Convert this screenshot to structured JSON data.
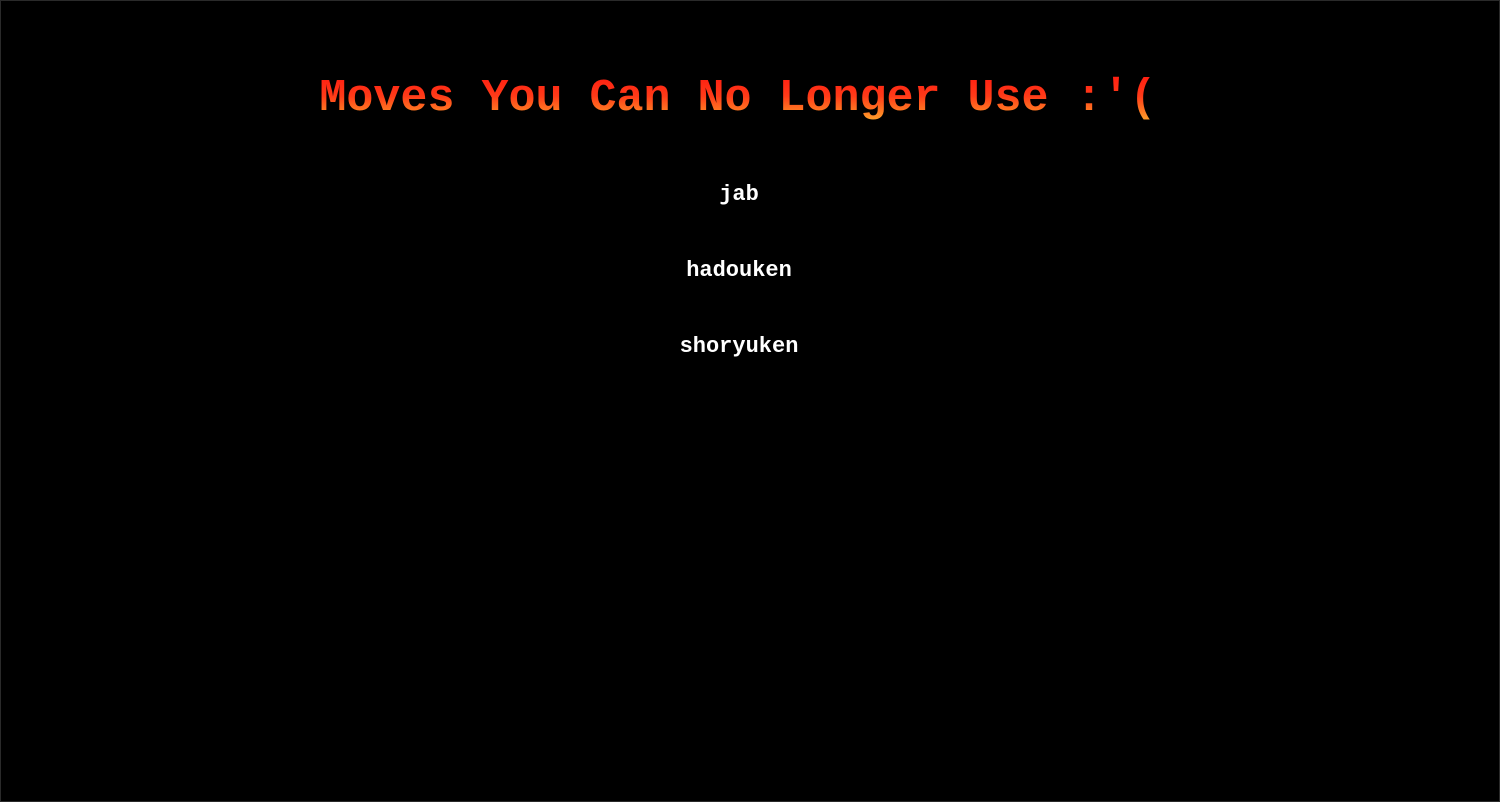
{
  "page": {
    "title": "Moves You Can No Longer Use :'(",
    "moves": [
      {
        "label": "jab"
      },
      {
        "label": "hadouken"
      },
      {
        "label": "shoryuken"
      }
    ]
  },
  "colors": {
    "background": "#000000",
    "title_gradient_top": "#ff1a10",
    "title_gradient_bottom": "#ffb030",
    "move_text": "#ffffff"
  }
}
